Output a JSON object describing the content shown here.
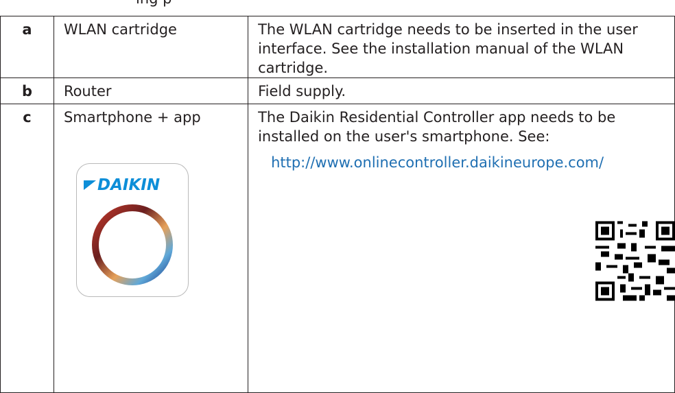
{
  "caption": "ing   p",
  "rows": [
    {
      "key": "a",
      "name": "WLAN cartridge",
      "description": "The WLAN cartridge needs to be inserted in the user interface. See the installation manual of the WLAN cartridge."
    },
    {
      "key": "b",
      "name": "Router",
      "description": "Field supply."
    },
    {
      "key": "c",
      "name": "Smartphone + app",
      "description": "The Daikin Residential Controller app needs to be installed on the user's smartphone. See:",
      "link": "http://www.onlinecontroller.daikineurope.com/"
    }
  ],
  "app_icon": {
    "brand_text": "DAIKIN",
    "brand_color": "#0d8ed8"
  },
  "icons": [
    "daikin-app-icon",
    "qr-code-icon"
  ]
}
